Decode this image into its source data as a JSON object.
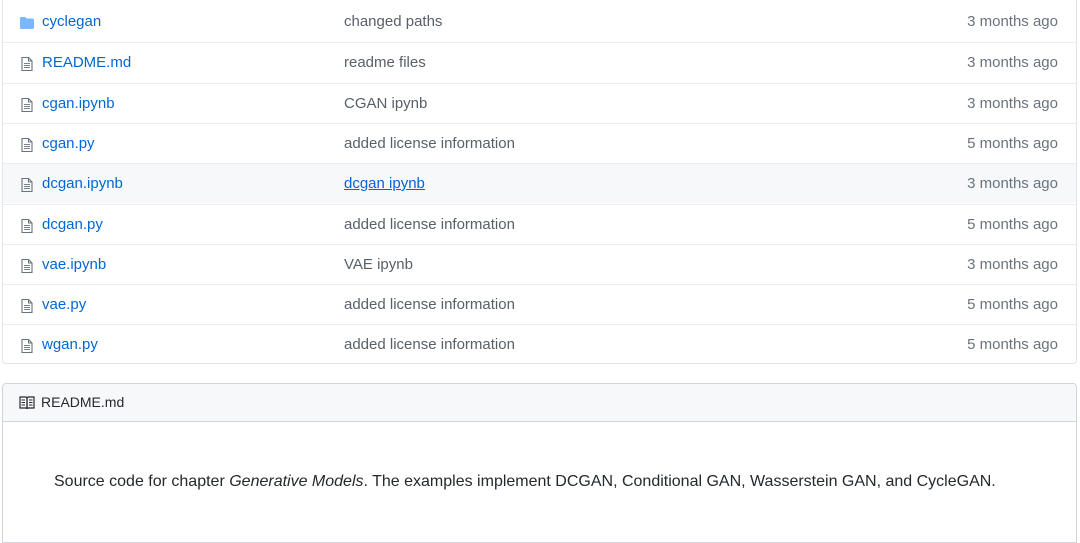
{
  "files": [
    {
      "name": "cyclegan",
      "type": "folder",
      "message": "changed paths",
      "age": "3 months ago"
    },
    {
      "name": "README.md",
      "type": "file",
      "message": "readme files",
      "age": "3 months ago"
    },
    {
      "name": "cgan.ipynb",
      "type": "file",
      "message": "CGAN ipynb",
      "age": "3 months ago"
    },
    {
      "name": "cgan.py",
      "type": "file",
      "message": "added license information",
      "age": "5 months ago"
    },
    {
      "name": "dcgan.ipynb",
      "type": "file",
      "message": "dcgan ipynb",
      "age": "3 months ago",
      "hovered": true
    },
    {
      "name": "dcgan.py",
      "type": "file",
      "message": "added license information",
      "age": "5 months ago"
    },
    {
      "name": "vae.ipynb",
      "type": "file",
      "message": "VAE ipynb",
      "age": "3 months ago"
    },
    {
      "name": "vae.py",
      "type": "file",
      "message": "added license information",
      "age": "5 months ago"
    },
    {
      "name": "wgan.py",
      "type": "file",
      "message": "added license information",
      "age": "5 months ago"
    }
  ],
  "readme": {
    "title": "README.md",
    "text_before": "Source code for chapter ",
    "text_emphasis": "Generative Models",
    "text_after": ". The examples implement DCGAN, Conditional GAN, Wasserstein GAN, and CycleGAN."
  },
  "colors": {
    "link": "#0366d6",
    "folder_icon": "#79b8ff",
    "file_icon": "#6a737d",
    "hover_row": "#f6f8fa"
  }
}
